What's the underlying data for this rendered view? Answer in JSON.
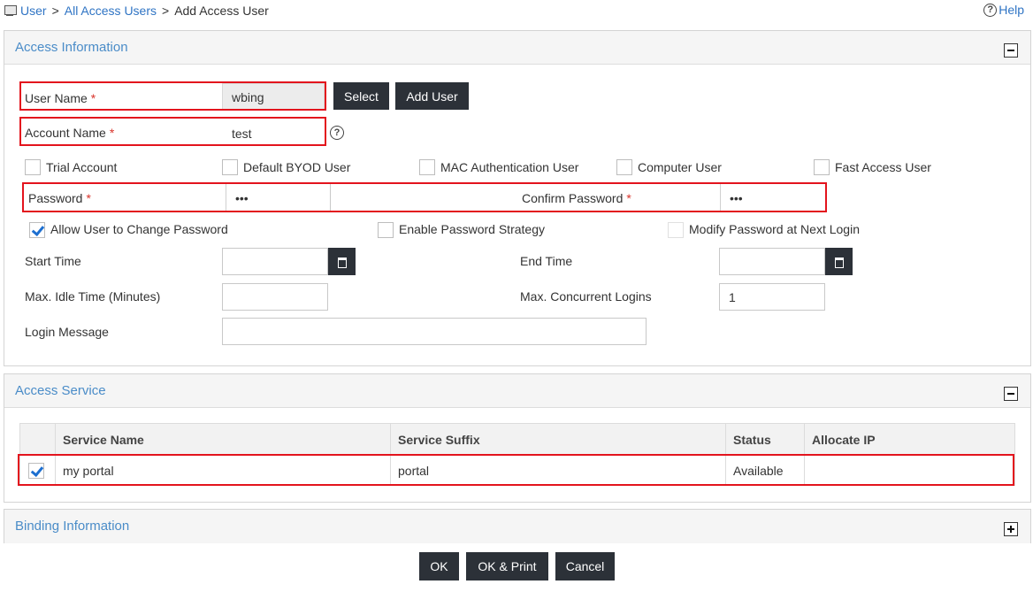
{
  "breadcrumb": {
    "items": [
      "User",
      "All Access Users"
    ],
    "current": "Add Access User",
    "separator": ">"
  },
  "help": {
    "label": "Help"
  },
  "access_info": {
    "title": "Access Information",
    "user_name": {
      "label": "User Name",
      "value": "wbing"
    },
    "account_name": {
      "label": "Account Name",
      "value": "test"
    },
    "required_mark": "*",
    "select_label": "Select",
    "add_user_label": "Add User",
    "options": [
      {
        "label": "Trial Account",
        "checked": false
      },
      {
        "label": "Default BYOD User",
        "checked": false
      },
      {
        "label": "MAC Authentication User",
        "checked": false
      },
      {
        "label": "Computer User",
        "checked": false
      },
      {
        "label": "Fast Access User",
        "checked": false
      }
    ],
    "password": {
      "label": "Password",
      "value": "•••"
    },
    "confirm_password": {
      "label": "Confirm Password",
      "value": "•••"
    },
    "password_options": [
      {
        "label": "Allow User to Change Password",
        "checked": true
      },
      {
        "label": "Enable Password Strategy",
        "checked": false
      },
      {
        "label": "Modify Password at Next Login",
        "checked": false
      }
    ],
    "start_time": {
      "label": "Start Time",
      "value": ""
    },
    "end_time": {
      "label": "End Time",
      "value": ""
    },
    "max_idle": {
      "label": "Max. Idle Time (Minutes)",
      "value": ""
    },
    "max_logins": {
      "label": "Max. Concurrent Logins",
      "value": "1"
    },
    "login_message": {
      "label": "Login Message",
      "value": ""
    }
  },
  "access_service": {
    "title": "Access Service",
    "columns": [
      "Service Name",
      "Service Suffix",
      "Status",
      "Allocate IP"
    ],
    "rows": [
      {
        "checked": true,
        "service_name": "my portal",
        "service_suffix": "portal",
        "status": "Available",
        "allocate_ip": ""
      }
    ]
  },
  "binding": {
    "title": "Binding Information"
  },
  "footer": {
    "ok": "OK",
    "ok_print": "OK & Print",
    "cancel": "Cancel"
  },
  "colors": {
    "accent": "#4a8cc8",
    "link": "#2f74c4",
    "button": "#2c3138",
    "highlight": "#e3141d",
    "required": "#d9342b"
  }
}
